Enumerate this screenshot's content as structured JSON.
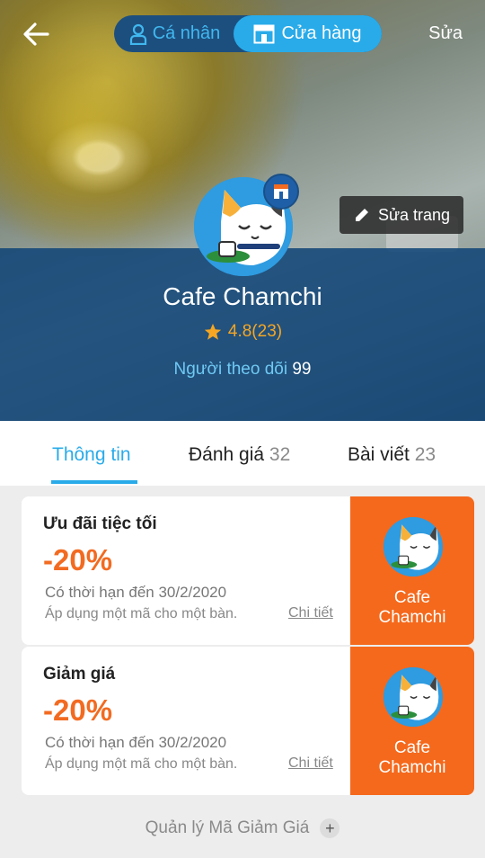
{
  "header": {
    "personal_label": "Cá nhân",
    "store_label": "Cửa hàng",
    "edit_label": "Sửa",
    "edit_page_label": "Sửa trang"
  },
  "profile": {
    "name": "Cafe Chamchi",
    "rating": "4.8(23)",
    "followers_label": "Người theo dõi",
    "followers_count": "99"
  },
  "tabs": [
    {
      "label": "Thông tin",
      "count": ""
    },
    {
      "label": "Đánh giá",
      "count": "32"
    },
    {
      "label": "Bài viết",
      "count": "23"
    }
  ],
  "coupons": [
    {
      "title": "Ưu đãi tiệc tối",
      "discount": "-20%",
      "expiry": "Có thời hạn đến 30/2/2020",
      "note": "Áp dụng một mã cho một bàn.",
      "detail": "Chi tiết",
      "brand_line1": "Cafe",
      "brand_line2": "Chamchi"
    },
    {
      "title": "Giảm giá",
      "discount": "-20%",
      "expiry": "Có thời hạn đến 30/2/2020",
      "note": "Áp dụng một mã cho một bàn.",
      "detail": "Chi tiết",
      "brand_line1": "Cafe",
      "brand_line2": "Chamchi"
    }
  ],
  "footer": {
    "manage_label": "Quản lý Mã Giảm Giá"
  },
  "colors": {
    "accent": "#29abe9",
    "orange": "#f5691c",
    "rating": "#f6a623"
  }
}
